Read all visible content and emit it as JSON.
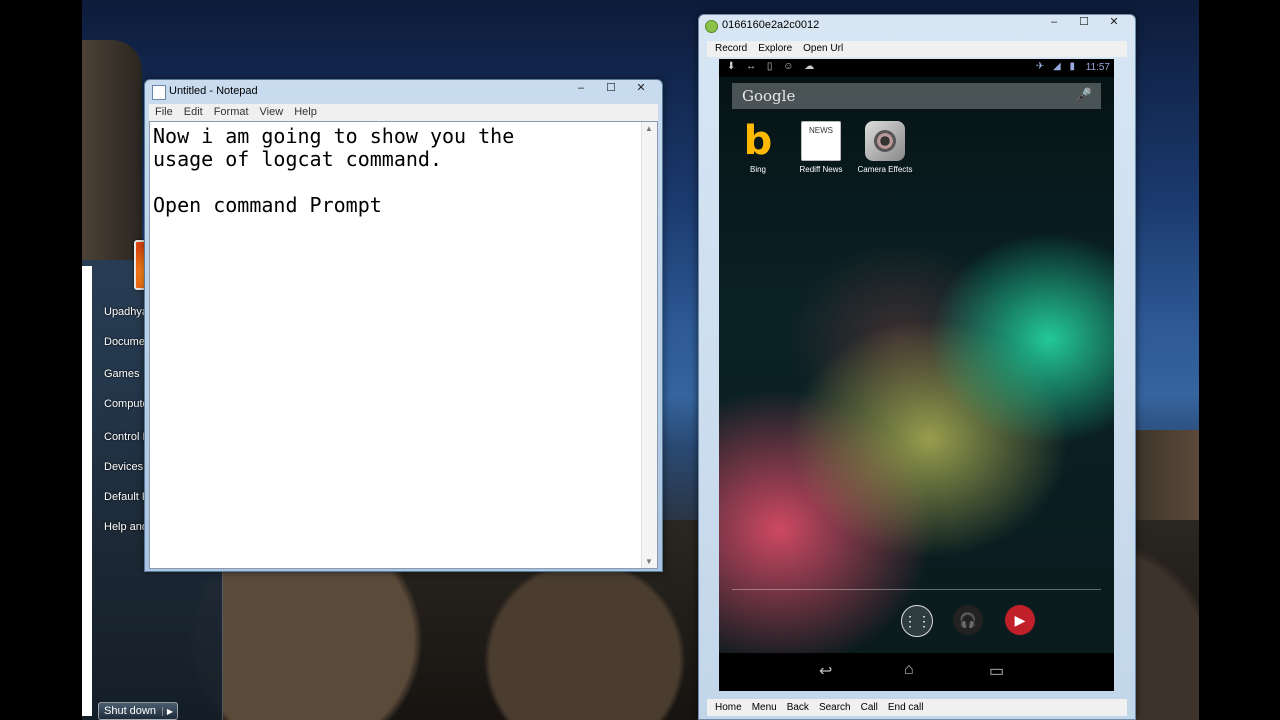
{
  "notepad": {
    "title": "Untitled - Notepad",
    "menu": [
      "File",
      "Edit",
      "Format",
      "View",
      "Help"
    ],
    "content": "Now i am going to show you the\nusage of logcat command.\n\nOpen command Prompt",
    "buttons": {
      "minimize": "‒",
      "maximize": "☐",
      "close": "✕"
    }
  },
  "start_menu": {
    "items": [
      "Upadhyay, Lavnya",
      "Documents",
      "Games",
      "Computer",
      "Control Panel",
      "Devices and Printers",
      "Default Programs",
      "Help and Support"
    ],
    "shutdown_label": "Shut down",
    "shutdown_arrow": "▶"
  },
  "phone_window": {
    "title": "0166160e2a2c0012",
    "toolbar": [
      "Record",
      "Explore",
      "Open Url"
    ],
    "bottom_bar": [
      "Home",
      "Menu",
      "Back",
      "Search",
      "Call",
      "End call"
    ],
    "buttons": {
      "minimize": "‒",
      "maximize": "☐",
      "close": "✕"
    }
  },
  "phone_screen": {
    "status_icons": "⬇ ↔ ▯ ☺ ☁",
    "signal_icons": "✈ ◢ ▮",
    "clock": "11:57",
    "search_brand": "Google",
    "mic_icon": "🎤",
    "apps": [
      {
        "label": "Bing",
        "icon": "bing-icon"
      },
      {
        "label": "Rediff News",
        "icon": "news-icon"
      },
      {
        "label": "Camera Effects",
        "icon": "camera-icon"
      }
    ],
    "bing_glyph": "b",
    "news_glyph": "NEWS",
    "dock": [
      {
        "icon": "app-drawer-icon",
        "glyph": "⋮⋮"
      },
      {
        "icon": "music-icon",
        "glyph": "🎧"
      },
      {
        "icon": "youtube-icon",
        "glyph": "▶"
      }
    ],
    "nav": {
      "back": "↩",
      "home": "⌂",
      "recents": "▭"
    }
  }
}
